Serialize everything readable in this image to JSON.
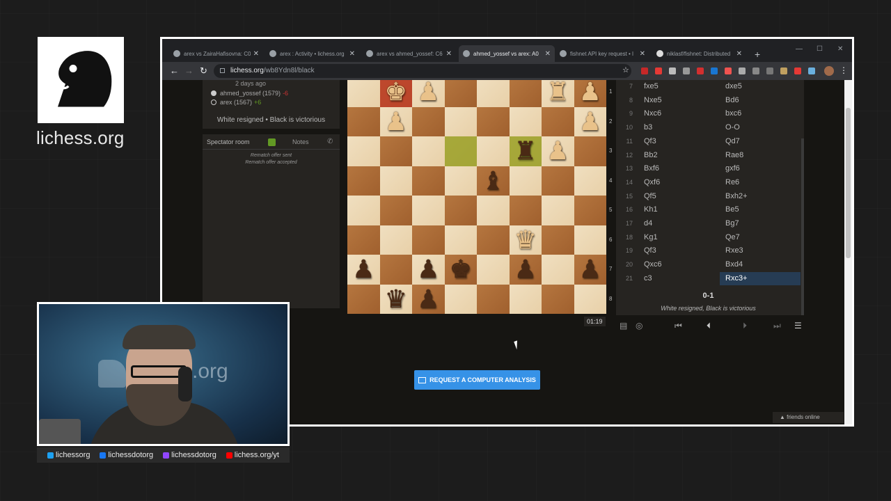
{
  "stream": {
    "brand": "lichess.org"
  },
  "browser": {
    "tabs": [
      {
        "label": "arex vs ZairaHafisovna: C0"
      },
      {
        "label": "arex : Activity • lichess.org"
      },
      {
        "label": "arex vs ahmed_yossef: C6"
      },
      {
        "label": "ahmed_yossef vs arex: A0"
      },
      {
        "label": "fishnet API key request • l"
      },
      {
        "label": "niklasf/fishnet: Distributed"
      }
    ],
    "url_host": "lichess.org",
    "url_path": "/wb8Ydn8l/black"
  },
  "game": {
    "ago": "2 days ago",
    "white_player": "ahmed_yossef (1579)",
    "white_diff": "-6",
    "black_player": "arex (1567)",
    "black_diff": "+6",
    "result_line": "White resigned • Black is victorious"
  },
  "spectator": {
    "room_label": "Spectator room",
    "notes_label": "Notes",
    "messages": [
      "Rematch offer sent",
      "Rematch offer accepted"
    ]
  },
  "board": {
    "ranks": [
      "1",
      "2",
      "3",
      "4",
      "5",
      "6",
      "7",
      "8"
    ],
    "clock": "01:19"
  },
  "moves": [
    {
      "n": "7",
      "w": "fxe5",
      "b": "dxe5"
    },
    {
      "n": "8",
      "w": "Nxe5",
      "b": "Bd6"
    },
    {
      "n": "9",
      "w": "Nxc6",
      "b": "bxc6"
    },
    {
      "n": "10",
      "w": "b3",
      "b": "O-O"
    },
    {
      "n": "11",
      "w": "Qf3",
      "b": "Qd7"
    },
    {
      "n": "12",
      "w": "Bb2",
      "b": "Rae8"
    },
    {
      "n": "13",
      "w": "Bxf6",
      "b": "gxf6"
    },
    {
      "n": "14",
      "w": "Qxf6",
      "b": "Re6"
    },
    {
      "n": "15",
      "w": "Qf5",
      "b": "Bxh2+"
    },
    {
      "n": "16",
      "w": "Kh1",
      "b": "Be5"
    },
    {
      "n": "17",
      "w": "d4",
      "b": "Bg7"
    },
    {
      "n": "18",
      "w": "Kg1",
      "b": "Qe7"
    },
    {
      "n": "19",
      "w": "Qf3",
      "b": "Rxe3"
    },
    {
      "n": "20",
      "w": "Qxc6",
      "b": "Bxd4"
    },
    {
      "n": "21",
      "w": "c3",
      "b": "Rxc3+"
    }
  ],
  "move_result": "0-1",
  "move_status": "White resigned, Black is victorious",
  "analysis_button": "REQUEST A COMPUTER ANALYSIS",
  "friends_online": "▲ friends online",
  "socials": [
    {
      "label": "lichessorg",
      "color": "#1da1f2"
    },
    {
      "label": "lichessdotorg",
      "color": "#1877f2"
    },
    {
      "label": "lichessdotorg",
      "color": "#9146ff"
    },
    {
      "label": "lichess.org/yt",
      "color": "#ff0000"
    }
  ]
}
